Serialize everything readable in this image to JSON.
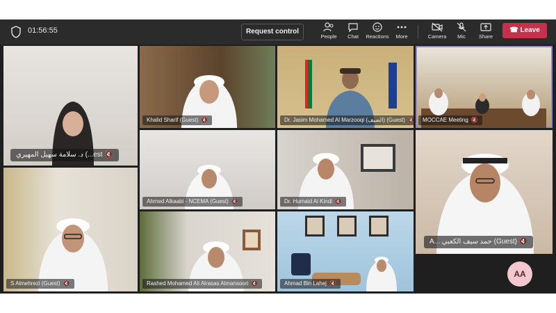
{
  "toolbar": {
    "timer": "01:56:55",
    "request_control": "Request control",
    "people": "People",
    "chat": "Chat",
    "reactions": "Reactions",
    "more": "More",
    "camera": "Camera",
    "mic": "Mic",
    "share": "Share",
    "leave": "Leave"
  },
  "colors": {
    "leave": "#c4314b",
    "selected_border": "#8b8cc7",
    "toolbar_bg": "#2b2b2b"
  },
  "participants": [
    {
      "name": "د. سلامة سهيل المهيري (Guest)",
      "display": "د. سلامة سهيل المهيري (...est"
    },
    {
      "name": "Khalid Sharif (Guest)"
    },
    {
      "name": "Dr. Jasim Mohamed Al Marzooqi (الضيف) (Guest)"
    },
    {
      "name": "MOCCAE Meeting"
    },
    {
      "name": "Ahmed Alkaabi - NCEMA (Guest)"
    },
    {
      "name": "Dr. Humaid Al Kindi"
    },
    {
      "name": "A... حمد سيف الكعبي (Guest)"
    },
    {
      "name": "S Almehrezi (Guest)"
    },
    {
      "name": "Rashed Mohamed Ali Alrasas Almansoori"
    },
    {
      "name": "Ahmad Bin Lahej"
    }
  ],
  "self_avatar": "AA"
}
